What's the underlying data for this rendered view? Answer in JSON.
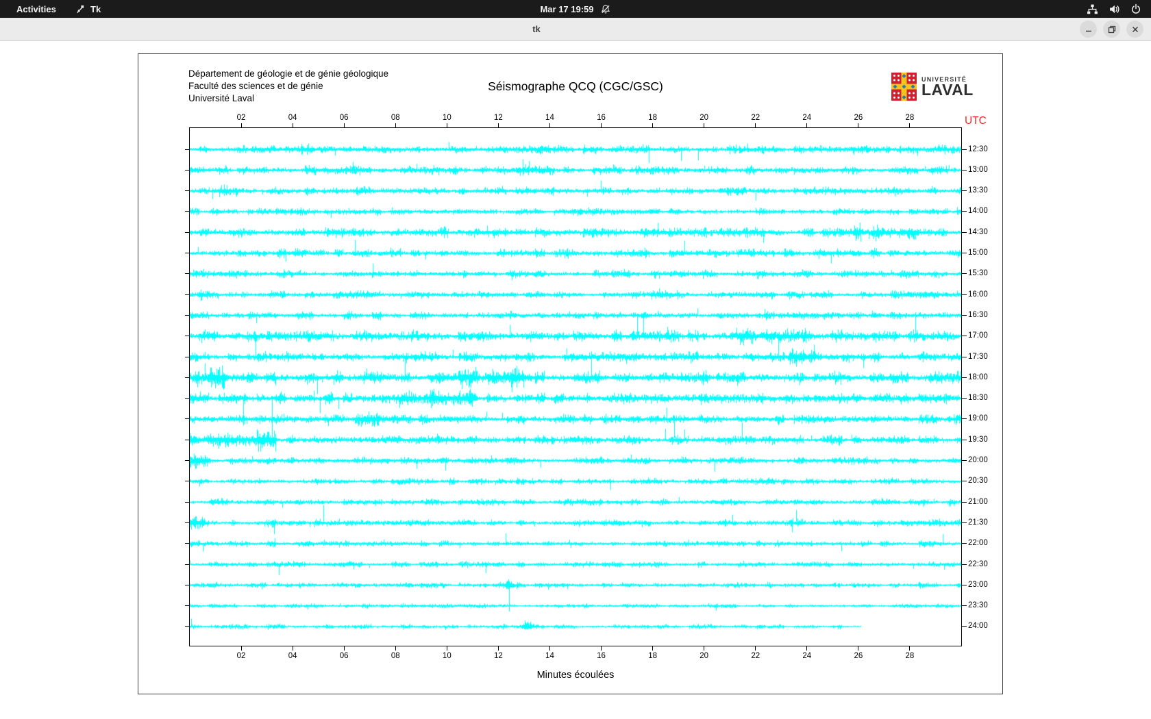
{
  "topbar": {
    "activities": "Activities",
    "app_label": "Tk",
    "clock": "Mar 17 19:59",
    "icons": [
      "tk-icon",
      "notifications-muted-icon",
      "network-wired-icon",
      "volume-icon",
      "power-icon"
    ]
  },
  "titlebar": {
    "title": "tk",
    "controls": [
      "minimize",
      "maximize",
      "close"
    ]
  },
  "frame": {
    "header": {
      "line1": "Département de géologie et de génie géologique",
      "line2": "Faculté des sciences et de génie",
      "line3": "Université Laval"
    },
    "title": "Séismographe QCQ (CGC/GSC)",
    "logo": {
      "line1": "UNIVERSITÉ",
      "line2": "LAVAL",
      "crest_colors": {
        "red": "#cf2030",
        "yellow": "#f6c21d",
        "blue": "#2878b8",
        "dots": "#ffffff"
      }
    }
  },
  "chart_data": {
    "type": "line",
    "title": "Séismographe QCQ (CGC/GSC)",
    "xlabel": "Minutes écoulées",
    "utc_label": "UTC",
    "trace_color": "#00ffff",
    "utc_color": "#ee2a22",
    "x_range_minutes": [
      0,
      30
    ],
    "x_ticks": [
      {
        "minute": 2,
        "label": "02"
      },
      {
        "minute": 4,
        "label": "04"
      },
      {
        "minute": 6,
        "label": "06"
      },
      {
        "minute": 8,
        "label": "08"
      },
      {
        "minute": 10,
        "label": "10"
      },
      {
        "minute": 12,
        "label": "12"
      },
      {
        "minute": 14,
        "label": "14"
      },
      {
        "minute": 16,
        "label": "16"
      },
      {
        "minute": 18,
        "label": "18"
      },
      {
        "minute": 20,
        "label": "20"
      },
      {
        "minute": 22,
        "label": "22"
      },
      {
        "minute": 24,
        "label": "24"
      },
      {
        "minute": 26,
        "label": "26"
      },
      {
        "minute": 28,
        "label": "28"
      }
    ],
    "traces": [
      {
        "label": "12:30",
        "amp": 3.2,
        "seed": 101,
        "end": 1,
        "bursts": [
          {
            "from": 4.3,
            "to": 5.6,
            "gain": 1.8
          }
        ]
      },
      {
        "label": "13:00",
        "amp": 3.4,
        "seed": 102,
        "end": 1,
        "bursts": [
          {
            "from": 12.3,
            "to": 13.2,
            "gain": 1.9
          }
        ]
      },
      {
        "label": "13:30",
        "amp": 3.0,
        "seed": 103,
        "end": 1,
        "bursts": [
          {
            "from": 0.8,
            "to": 2.1,
            "gain": 1.8
          }
        ]
      },
      {
        "label": "14:00",
        "amp": 2.7,
        "seed": 104,
        "end": 1,
        "bursts": []
      },
      {
        "label": "14:30",
        "amp": 3.8,
        "seed": 105,
        "end": 1,
        "bursts": [
          {
            "from": 25.8,
            "to": 28.6,
            "gain": 1.7
          }
        ]
      },
      {
        "label": "15:00",
        "amp": 3.4,
        "seed": 106,
        "end": 1,
        "bursts": []
      },
      {
        "label": "15:30",
        "amp": 3.0,
        "seed": 107,
        "end": 1,
        "bursts": []
      },
      {
        "label": "16:00",
        "amp": 3.0,
        "seed": 108,
        "end": 1,
        "bursts": []
      },
      {
        "label": "16:30",
        "amp": 3.0,
        "seed": 109,
        "end": 1,
        "bursts": []
      },
      {
        "label": "17:00",
        "amp": 4.2,
        "seed": 110,
        "end": 1,
        "bursts": [
          {
            "from": 21.0,
            "to": 24.0,
            "gain": 1.7
          }
        ]
      },
      {
        "label": "17:30",
        "amp": 3.8,
        "seed": 111,
        "end": 1,
        "bursts": [
          {
            "from": 23.3,
            "to": 24.3,
            "gain": 2.0
          }
        ]
      },
      {
        "label": "18:00",
        "amp": 5.0,
        "seed": 112,
        "end": 1,
        "bursts": [
          {
            "from": 0.2,
            "to": 1.4,
            "gain": 1.8
          },
          {
            "from": 10.0,
            "to": 13.0,
            "gain": 1.5
          }
        ]
      },
      {
        "label": "18:30",
        "amp": 4.6,
        "seed": 113,
        "end": 1,
        "bursts": [
          {
            "from": 8.0,
            "to": 11.0,
            "gain": 1.5
          }
        ]
      },
      {
        "label": "19:00",
        "amp": 3.8,
        "seed": 114,
        "end": 1,
        "bursts": [
          {
            "from": 6.4,
            "to": 7.4,
            "gain": 1.8
          }
        ]
      },
      {
        "label": "19:30",
        "amp": 3.4,
        "seed": 115,
        "end": 1,
        "bursts": [
          {
            "from": 0.0,
            "to": 3.4,
            "gain": 2.4
          }
        ]
      },
      {
        "label": "20:00",
        "amp": 2.8,
        "seed": 116,
        "end": 1,
        "bursts": [
          {
            "from": 0.0,
            "to": 0.8,
            "gain": 2.0
          }
        ]
      },
      {
        "label": "20:30",
        "amp": 2.6,
        "seed": 117,
        "end": 1,
        "bursts": []
      },
      {
        "label": "21:00",
        "amp": 2.6,
        "seed": 118,
        "end": 1,
        "bursts": []
      },
      {
        "label": "21:30",
        "amp": 2.6,
        "seed": 119,
        "end": 1,
        "bursts": [
          {
            "from": 0.0,
            "to": 0.6,
            "gain": 2.2
          }
        ]
      },
      {
        "label": "22:00",
        "amp": 2.4,
        "seed": 120,
        "end": 1,
        "bursts": []
      },
      {
        "label": "22:30",
        "amp": 2.2,
        "seed": 121,
        "end": 1,
        "bursts": []
      },
      {
        "label": "23:00",
        "amp": 2.0,
        "seed": 122,
        "end": 1,
        "bursts": [
          {
            "from": 11.9,
            "to": 12.5,
            "gain": 2.4
          }
        ]
      },
      {
        "label": "23:30",
        "amp": 1.6,
        "seed": 123,
        "end": 1,
        "bursts": []
      },
      {
        "label": "24:00",
        "amp": 1.8,
        "seed": 124,
        "end": 0.87,
        "bursts": [
          {
            "from": 12.9,
            "to": 13.3,
            "gain": 2.6
          }
        ]
      }
    ]
  }
}
